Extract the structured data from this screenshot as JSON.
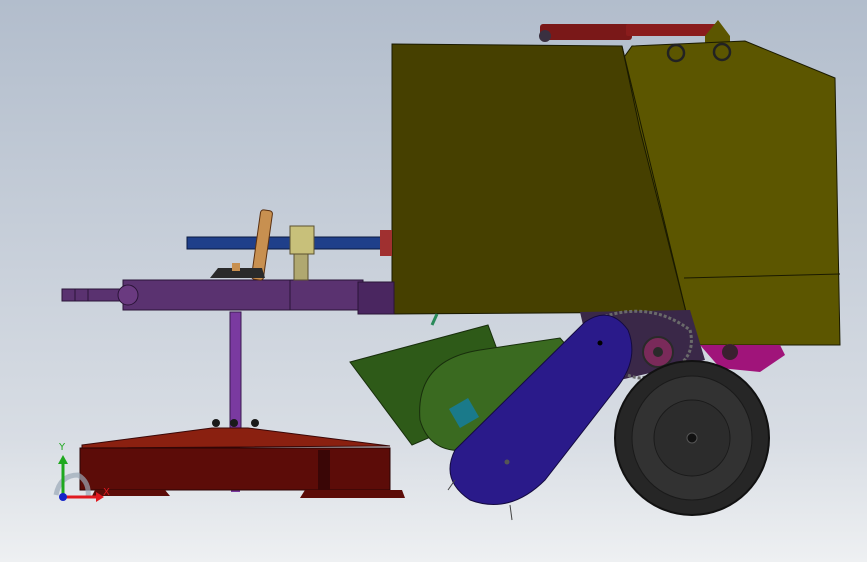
{
  "viewport": {
    "background": [
      "#b2bdcc",
      "#eef0f2"
    ]
  },
  "triad": {
    "x_label": "X",
    "y_label": "Y",
    "x_color": "#e0191f",
    "y_color": "#1ea81e",
    "origin_color": "#1424c8"
  },
  "colors": {
    "bale_chamber": "#464000",
    "tailgate": "#5c5600",
    "frame": "#5a3270",
    "pto_shaft": "#1f3f8a",
    "mower_deck": "#5c0c08",
    "mower_top": "#8a2010",
    "pickup_guard": "#2e5a18",
    "pickup_drum": "#2a1a8a",
    "wheel": "#2a2a2a",
    "hydraulic_cylinder": "#7a1818",
    "drive_chain": "#3a2848",
    "accent_magenta": "#a0147a"
  }
}
